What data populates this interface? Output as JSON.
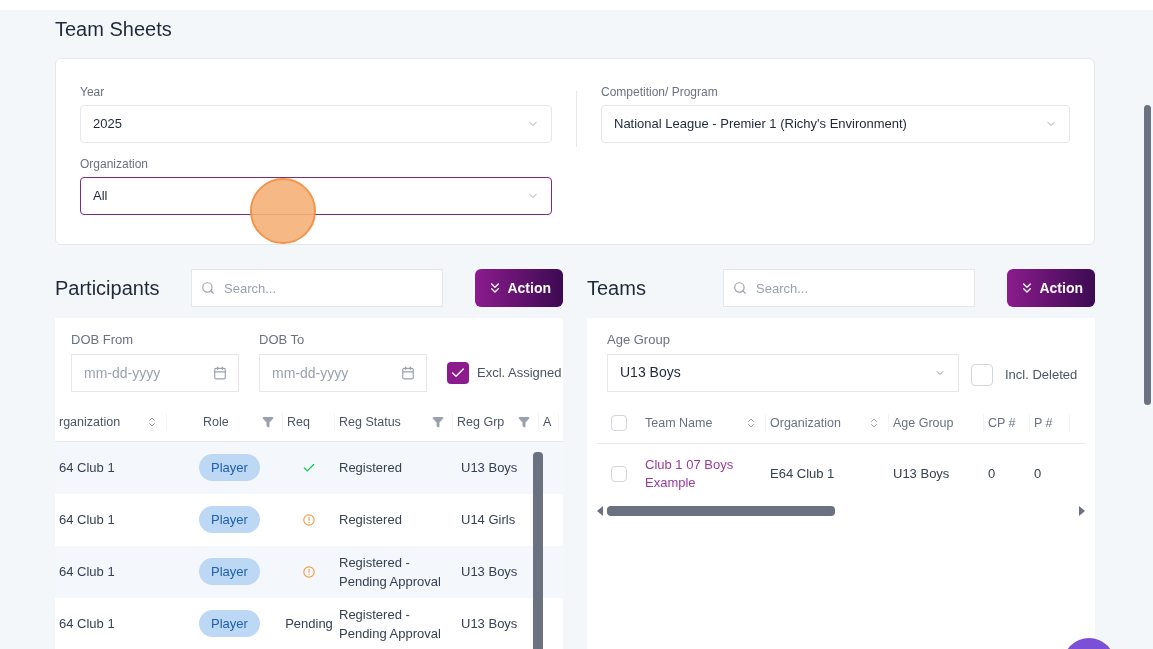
{
  "page": {
    "title": "Team Sheets"
  },
  "filters": {
    "year": {
      "label": "Year",
      "value": "2025"
    },
    "competition": {
      "label": "Competition/ Program",
      "value": "National League - Premier 1 (Richy's Environment)"
    },
    "organization": {
      "label": "Organization",
      "value": "All",
      "focused": true
    }
  },
  "participants": {
    "title": "Participants",
    "search": {
      "placeholder": "Search..."
    },
    "action": "Action",
    "dob_from": {
      "label": "DOB From",
      "placeholder": "mm-dd-yyyy"
    },
    "dob_to": {
      "label": "DOB To",
      "placeholder": "mm-dd-yyyy"
    },
    "excl_assigned": {
      "label": "Excl. Assigned",
      "checked": true
    },
    "columns": [
      {
        "label": "rganization",
        "kind": "sort"
      },
      {
        "label": "Role",
        "kind": "filter"
      },
      {
        "label": "Req",
        "kind": "plain"
      },
      {
        "label": "Reg Status",
        "kind": "filter"
      },
      {
        "label": "Reg Grp",
        "kind": "filter"
      },
      {
        "label": "A",
        "kind": "plain"
      }
    ],
    "rows": [
      {
        "organization": "64 Club 1",
        "role": "Player",
        "req": {
          "kind": "check"
        },
        "reg_status": "Registered",
        "reg_grp": "U13 Boys"
      },
      {
        "organization": "64 Club 1",
        "role": "Player",
        "req": {
          "kind": "warning"
        },
        "reg_status": "Registered",
        "reg_grp": "U14 Girls"
      },
      {
        "organization": "64 Club 1",
        "role": "Player",
        "req": {
          "kind": "warning"
        },
        "reg_status": "Registered - Pending Approval",
        "reg_grp": "U13 Boys"
      },
      {
        "organization": "64 Club 1",
        "role": "Player",
        "req": {
          "kind": "text",
          "text": "Pending"
        },
        "reg_status": "Registered - Pending Approval",
        "reg_grp": "U13 Boys"
      }
    ]
  },
  "teams": {
    "title": "Teams",
    "search": {
      "placeholder": "Search..."
    },
    "action": "Action",
    "age_group": {
      "label": "Age Group",
      "value": "U13 Boys"
    },
    "incl_deleted": {
      "label": "Incl. Deleted",
      "checked": false
    },
    "select_all_checked": false,
    "columns": [
      {
        "label": "Team Name",
        "kind": "sort"
      },
      {
        "label": "Organization",
        "kind": "sort"
      },
      {
        "label": "Age Group",
        "kind": "plain"
      },
      {
        "label": "CP #",
        "kind": "plain"
      },
      {
        "label": "P #",
        "kind": "plain"
      }
    ],
    "rows": [
      {
        "checked": false,
        "team_name": "Club 1 07 Boys Example",
        "organization": "E64 Club 1",
        "age_group": "U13 Boys",
        "cp": "0",
        "p": "0"
      }
    ]
  }
}
